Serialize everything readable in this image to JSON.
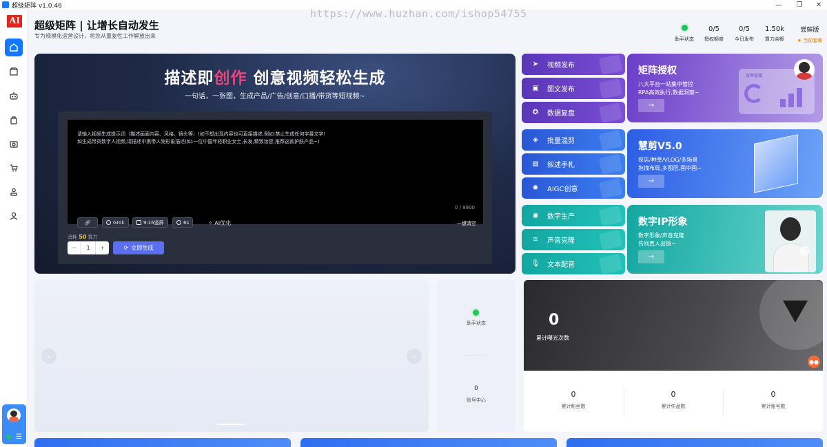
{
  "window": {
    "title": "超级矩阵 v1.0.46"
  },
  "watermark": "https://www.huzhan.com/ishop54755",
  "header": {
    "title": "超级矩阵 | 让增长自动发生",
    "subtitle": "专为规模化运营设计，将您从重复性工作解放出来",
    "stats": [
      {
        "value": "",
        "label": "助手状态"
      },
      {
        "value": "0/5",
        "label": "授权额度"
      },
      {
        "value": "0/5",
        "label": "今日发布"
      },
      {
        "value": "1.50k",
        "label": "算力余额"
      }
    ],
    "plan": {
      "value": "尝鲜版",
      "label": "当前套餐"
    }
  },
  "sidebar": {
    "logo": "AI",
    "items": [
      "home-icon",
      "box-icon",
      "robot-icon",
      "bag-icon",
      "camera-icon",
      "cart-icon",
      "stamp-icon",
      "user-icon"
    ]
  },
  "hero": {
    "title_pre": "描述即",
    "title_hl": "创作",
    "title_post": " 创意视频轻松生成",
    "subtitle": "一句话，一张图，生成产品/广告/创意/口播/带货等短视频~",
    "prompt_line1": "请输入视频生成提示词（描述画面内容、风格、镜头等）!如不想出现内容也可直接描述,例如:禁止生成任何字幕文字!",
    "prompt_line2": "如生成带货数字人视频,请描述中携带人物形象描述(如:一位中国年轻职业女士,长发,精致妆容,推荐这款护肤产品~)",
    "counter": "0 / 9900",
    "tools": {
      "model": "Grok",
      "ratio": "9:16竖屏",
      "duration": "6s",
      "ai_optimize": "AI优化",
      "clear": "一键清空"
    },
    "cost_prefix": "消耗",
    "cost_value": "50",
    "cost_suffix": "算力",
    "quantity": "1",
    "minus": "−",
    "plus": "+",
    "generate": "立即生成"
  },
  "tiles": {
    "video_publish": "视频发布",
    "image_publish": "图文发布",
    "data_review": "数据复盘",
    "batch_mix": "批量混剪",
    "narration": "叙述手札",
    "aigc": "AIGC创意",
    "digital_production": "数字生产",
    "voice_clone": "声音克隆",
    "text_dub": "文本配音"
  },
  "promos": {
    "matrix": {
      "title": "矩阵授权",
      "line1": "八大平台一站集中管控",
      "line2": "RPA高效执行,数据洞察~",
      "art_label": "效率倍增"
    },
    "edit": {
      "title": "慧剪V5.0",
      "line1": "探店/种草/VLOG/多场景",
      "line2": "拖拽布局,多图层,画中画~"
    },
    "ip": {
      "title": "数字IP形象",
      "line1": "数字形象/声音克隆",
      "line2": "告别真人出镜~"
    },
    "arrow": "→"
  },
  "side_stat": {
    "label1": "助手状态",
    "value2": "0",
    "label2": "账号中心"
  },
  "exposure": {
    "value": "0",
    "label": "累计曝光次数",
    "cols": [
      {
        "value": "0",
        "label": "累计粉丝数"
      },
      {
        "value": "0",
        "label": "累计作品数"
      },
      {
        "value": "0",
        "label": "累计账号数"
      }
    ]
  },
  "carousel": {
    "prev": "‹",
    "next": "›"
  }
}
